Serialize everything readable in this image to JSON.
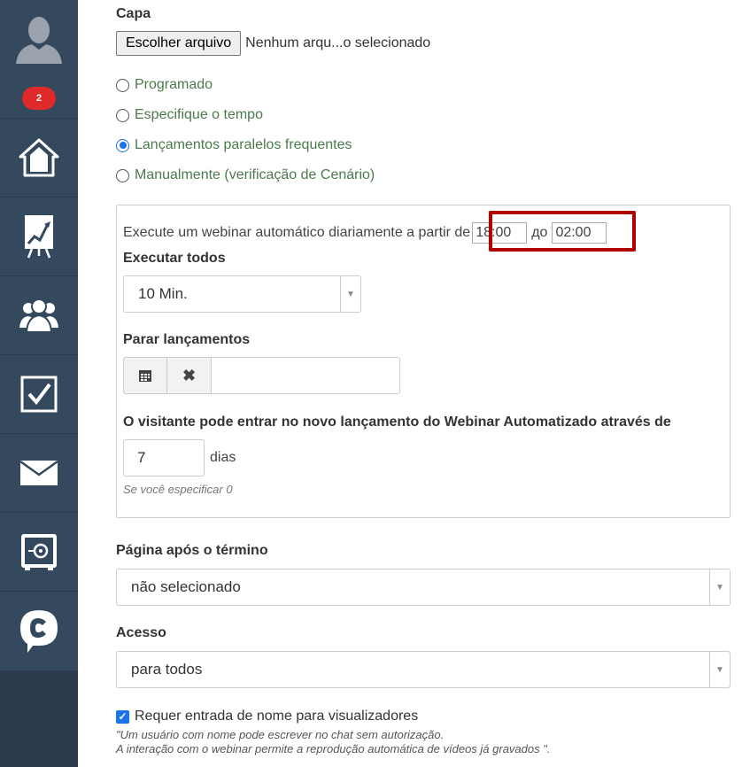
{
  "sidebar": {
    "badge_count": "2",
    "items": [
      {
        "icon": "home-icon"
      },
      {
        "icon": "chart-board-icon"
      },
      {
        "icon": "users-icon"
      },
      {
        "icon": "checkbox-icon"
      },
      {
        "icon": "mail-icon"
      },
      {
        "icon": "safe-icon"
      },
      {
        "icon": "chat-logo-icon"
      }
    ]
  },
  "cover": {
    "label": "Capa",
    "file_button": "Escolher arquivo",
    "file_status": "Nenhum arqu...o selecionado"
  },
  "launch_modes": [
    {
      "label": "Programado",
      "checked": false
    },
    {
      "label": "Especifique o tempo",
      "checked": false
    },
    {
      "label": "Lançamentos paralelos frequentes",
      "checked": true
    },
    {
      "label": "Manualmente (verificação de Cenário)",
      "checked": false
    }
  ],
  "schedule": {
    "prefix": "Execute um webinar automático diariamente a partir de",
    "start_time": "18:00",
    "separator": "до",
    "end_time": "02:00",
    "run_every_label": "Executar todos",
    "run_every_value": "10 Min.",
    "stop_label": "Parar lançamentos",
    "stop_value": "",
    "visitor_label": "O visitante pode entrar no novo lançamento do Webinar Automatizado através de",
    "days_value": "7",
    "days_unit": "dias",
    "hint": "Se você especificar 0"
  },
  "page_after": {
    "label": "Página após o término",
    "value": "não selecionado"
  },
  "access": {
    "label": "Acesso",
    "value": "para todos"
  },
  "require_name": {
    "label": "Requer entrada de nome para visualizadores",
    "checked": true,
    "note_line1": "\"Um usuário com nome pode escrever no chat sem autorização.",
    "note_line2": "A interação com o webinar permite a reprodução automática de vídeos já gravados \"."
  },
  "colors": {
    "sidebar": "#34495e",
    "badge": "#e02a2a",
    "highlight": "#b00000",
    "radio_label": "#4b7a4b",
    "accent": "#1a73e8"
  }
}
